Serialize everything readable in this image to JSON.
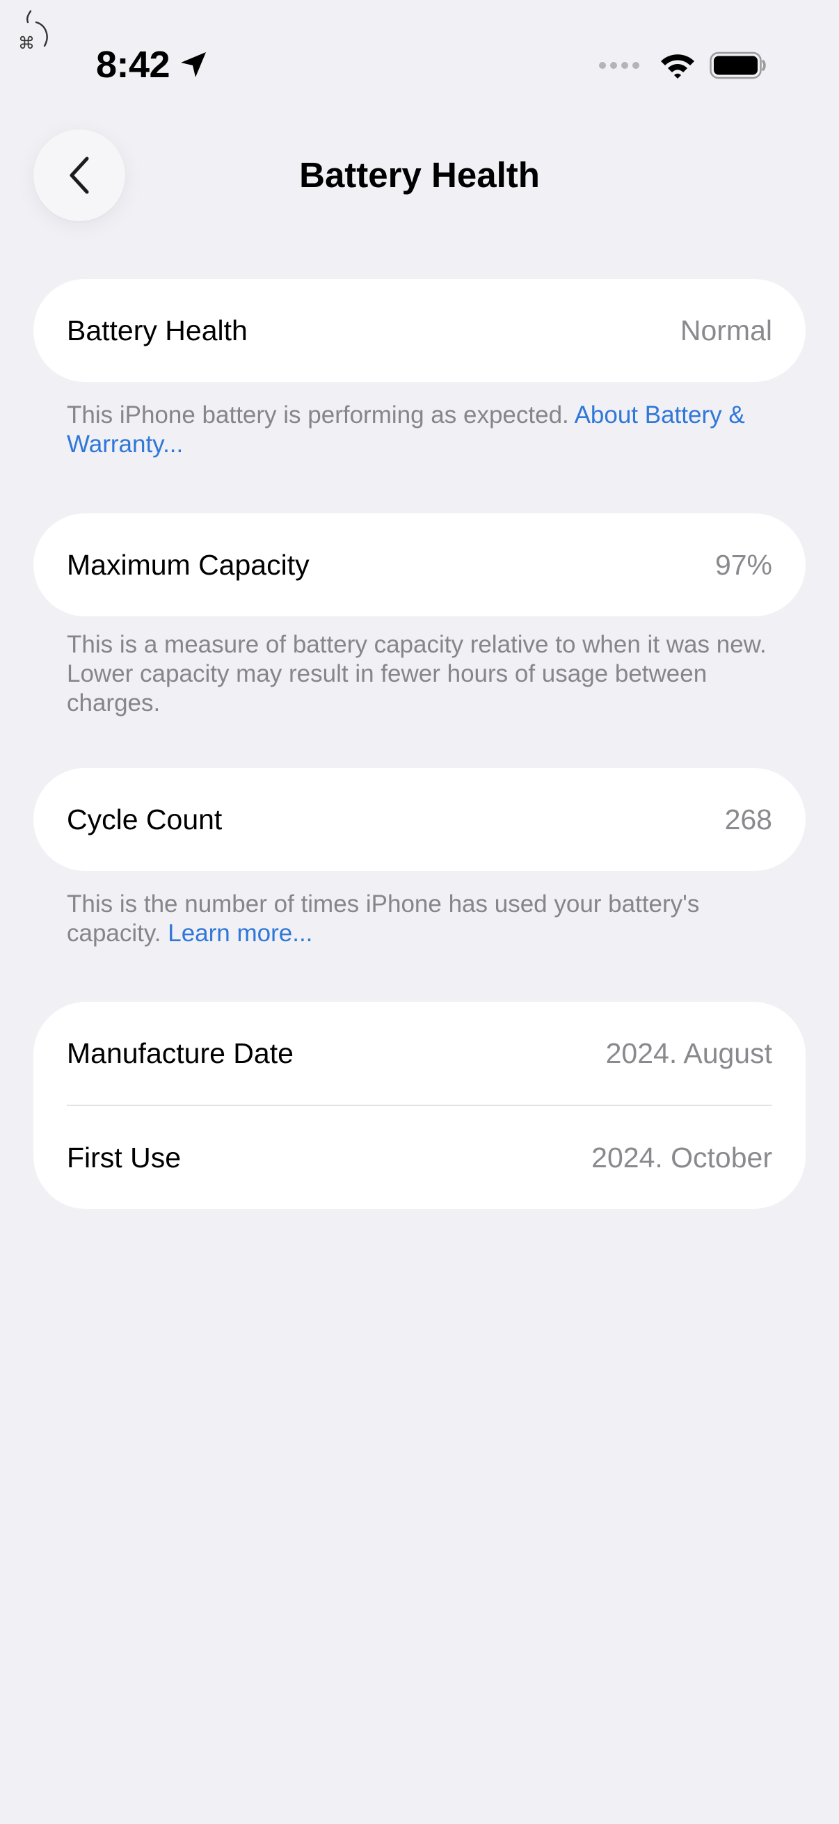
{
  "status_bar": {
    "time": "8:42"
  },
  "nav": {
    "title": "Battery Health"
  },
  "sections": {
    "battery_health": {
      "label": "Battery Health",
      "value": "Normal",
      "footnote_text": "This iPhone battery is performing as expected. ",
      "footnote_link": "About Battery & Warranty..."
    },
    "maximum_capacity": {
      "label": "Maximum Capacity",
      "value": "97%",
      "footnote_text": "This is a measure of battery capacity relative to when it was new. Lower capacity may result in fewer hours of usage between charges."
    },
    "cycle_count": {
      "label": "Cycle Count",
      "value": "268",
      "footnote_text": "This is the number of times iPhone has used your battery's capacity. ",
      "footnote_link": "Learn more..."
    },
    "dates": {
      "manufacture_label": "Manufacture Date",
      "manufacture_value": "2024. August",
      "first_use_label": "First Use",
      "first_use_value": "2024. October"
    }
  },
  "colors": {
    "background": "#f0f0f5",
    "card": "#ffffff",
    "secondary_text": "#8a8a8e",
    "link": "#2f77d8"
  },
  "icons": [
    "back-chevron-icon",
    "location-arrow-icon",
    "cellular-signal-icon",
    "wifi-icon",
    "battery-icon"
  ]
}
